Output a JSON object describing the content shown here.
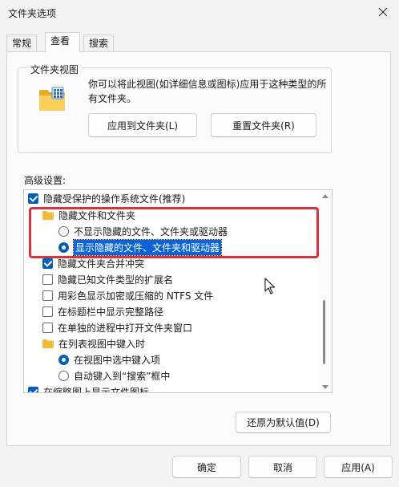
{
  "window": {
    "title": "文件夹选项",
    "close_icon": "close-icon"
  },
  "tabs": [
    {
      "label": "常规",
      "active": false
    },
    {
      "label": "查看",
      "active": true
    },
    {
      "label": "搜索",
      "active": false
    }
  ],
  "folder_views": {
    "group_label": "文件夹视图",
    "icon": "folder-grid-icon",
    "description": "你可以将此视图(如详细信息或图标)应用于这种类型的所有文件夹。",
    "apply_button": "应用到文件夹(L)",
    "reset_button": "重置文件夹(R)"
  },
  "advanced": {
    "label": "高级设置:",
    "items": [
      {
        "type": "checkbox",
        "checked": true,
        "label": "隐藏受保护的操作系统文件(推荐)"
      },
      {
        "type": "folder",
        "label": "隐藏文件和文件夹"
      },
      {
        "type": "radio",
        "checked": false,
        "label": "不显示隐藏的文件、文件夹或驱动器"
      },
      {
        "type": "radio",
        "checked": true,
        "label": "显示隐藏的文件、文件夹和驱动器",
        "selected": true
      },
      {
        "type": "checkbox",
        "checked": true,
        "label": "隐藏文件夹合并冲突"
      },
      {
        "type": "checkbox",
        "checked": false,
        "label": "隐藏已知文件类型的扩展名"
      },
      {
        "type": "checkbox",
        "checked": false,
        "label": "用彩色显示加密或压缩的 NTFS 文件"
      },
      {
        "type": "checkbox",
        "checked": false,
        "label": "在标题栏中显示完整路径"
      },
      {
        "type": "checkbox",
        "checked": false,
        "label": "在单独的进程中打开文件夹窗口"
      },
      {
        "type": "folder",
        "label": "在列表视图中键入时"
      },
      {
        "type": "radio",
        "checked": true,
        "label": "在视图中选中键入项"
      },
      {
        "type": "radio",
        "checked": false,
        "label": "自动键入到“搜索”框中"
      },
      {
        "type": "checkbox",
        "checked": true,
        "label": "在缩略图上显示文件图标"
      }
    ]
  },
  "restore_button": "还原为默认值(D)",
  "footer": {
    "ok": "确定",
    "cancel": "取消",
    "apply": "应用(A)"
  },
  "colors": {
    "accent": "#005fb8",
    "highlight": "#d8323a"
  }
}
